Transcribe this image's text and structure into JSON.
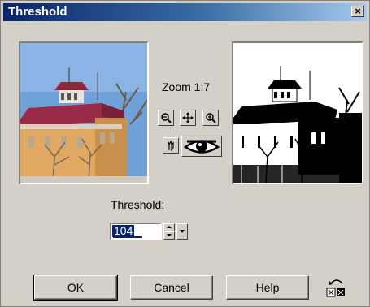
{
  "dialog": {
    "title": "Threshold",
    "close_glyph": "×"
  },
  "zoom": {
    "label": "Zoom 1:7"
  },
  "tools": [
    {
      "name": "zoom-out-icon",
      "glyph": "🔍"
    },
    {
      "name": "pan-icon",
      "glyph": "✥"
    },
    {
      "name": "zoom-in-icon",
      "glyph": "🔍"
    },
    {
      "name": "hand-icon",
      "glyph": "☝"
    },
    {
      "name": "eye-icon"
    }
  ],
  "threshold": {
    "label": "Threshold:",
    "value": "104"
  },
  "buttons": {
    "ok": "OK",
    "cancel": "Cancel",
    "help": "Help"
  },
  "colors": {
    "title_start": "#0a246a",
    "title_end": "#a6caf0",
    "face": "#d4d0c8"
  }
}
